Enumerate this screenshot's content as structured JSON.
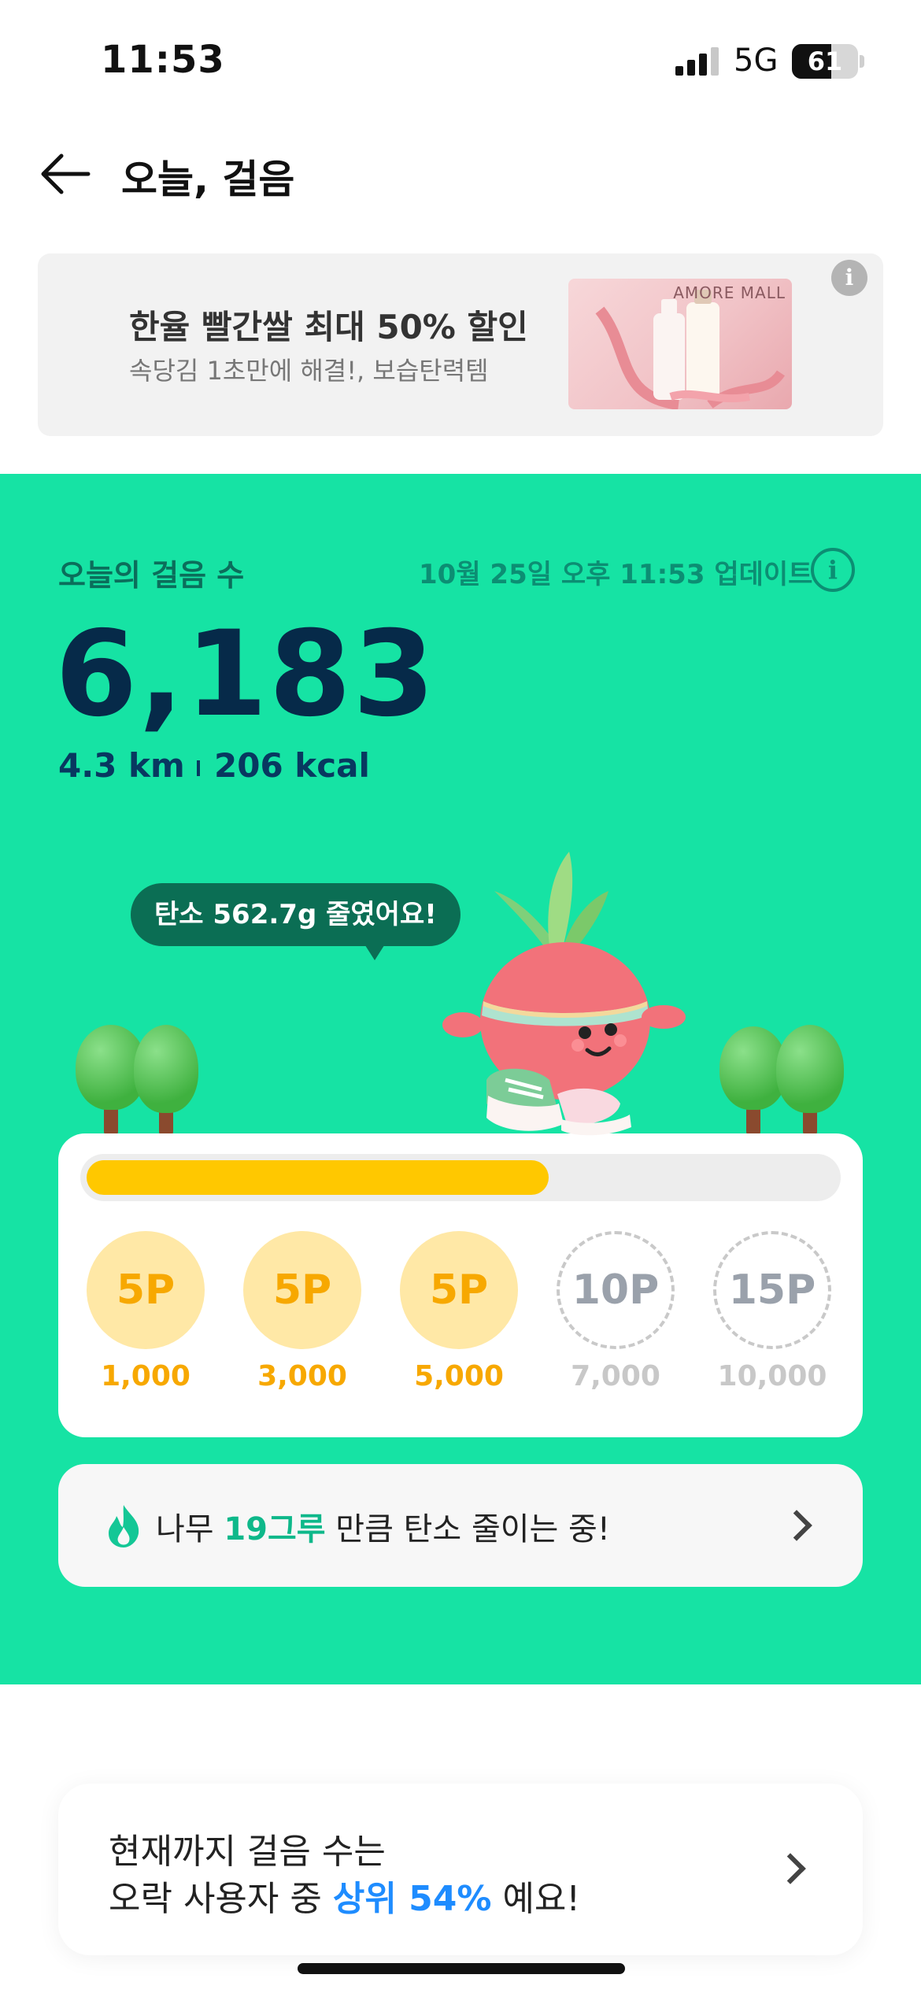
{
  "status_bar": {
    "time": "11:53",
    "network": "5G",
    "battery": "61"
  },
  "header": {
    "title": "오늘, 걸음"
  },
  "ad": {
    "title": "한율 빨간쌀 최대 50% 할인",
    "subtitle": "속당김 1초만에 해결!, 보습탄력템",
    "brand": "AMORE MALL"
  },
  "today": {
    "label": "오늘의 걸음 수",
    "updated": "10월 25일 오후 11:53 업데이트",
    "steps": "6,183",
    "distance": "4.3 km",
    "calories": "206 kcal",
    "carbon_bubble": "탄소 562.7g 줄였어요!"
  },
  "rewards": {
    "progress_fraction": 0.6183,
    "milestones": [
      {
        "points": "5P",
        "steps": "1,000",
        "achieved": true
      },
      {
        "points": "5P",
        "steps": "3,000",
        "achieved": true
      },
      {
        "points": "5P",
        "steps": "5,000",
        "achieved": true
      },
      {
        "points": "10P",
        "steps": "7,000",
        "achieved": false
      },
      {
        "points": "15P",
        "steps": "10,000",
        "achieved": false
      }
    ]
  },
  "trees": {
    "prefix": "나무 ",
    "highlight": "19그루",
    "suffix": " 만큼 탄소 줄이는 중!"
  },
  "ranking": {
    "line1": "현재까지 걸음 수는",
    "line2_prefix": "오락 사용자 중 ",
    "line2_highlight": "상위 54%",
    "line2_suffix": " 예요!"
  },
  "colors": {
    "brand_green": "#16e3a4",
    "progress_yellow": "#ffc800",
    "accent_blue": "#1e8cff"
  }
}
